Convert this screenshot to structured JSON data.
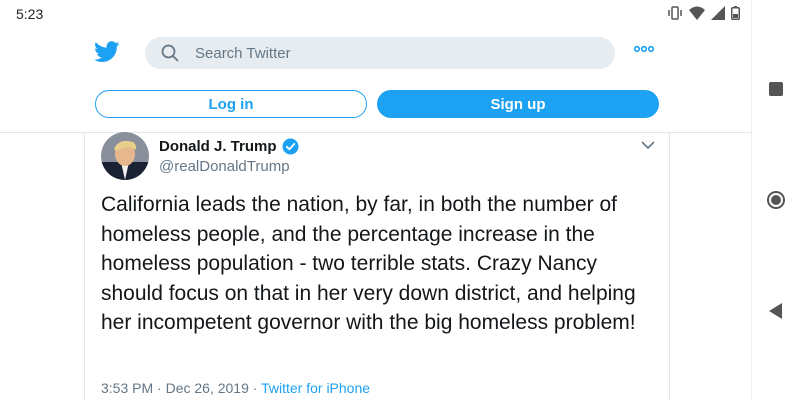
{
  "status_bar": {
    "time": "5:23"
  },
  "header": {
    "search": {
      "placeholder": "Search Twitter"
    },
    "login_label": "Log in",
    "signup_label": "Sign up"
  },
  "tweet": {
    "author_name": "Donald J. Trump",
    "handle": "@realDonaldTrump",
    "verified": true,
    "text": "California leads the nation, by far, in both the number of homeless people, and the percentage increase in the homeless population - two terrible stats. Crazy Nancy should focus on that in her very down district, and helping her incompetent governor with the big homeless problem!",
    "time": "3:53 PM",
    "separator": "·",
    "date": "Dec 26, 2019",
    "source": "Twitter for iPhone"
  },
  "colors": {
    "accent": "#1da1f2",
    "secondary_text": "#657786",
    "search_bg": "#e6ecf0"
  },
  "icons": [
    "twitter-bird-icon",
    "search-icon",
    "more-icon",
    "verified-icon",
    "chevron-down-icon",
    "vibrate-icon",
    "wifi-icon",
    "signal-icon",
    "battery-icon",
    "square-nav-icon",
    "circle-nav-icon",
    "back-nav-icon"
  ]
}
